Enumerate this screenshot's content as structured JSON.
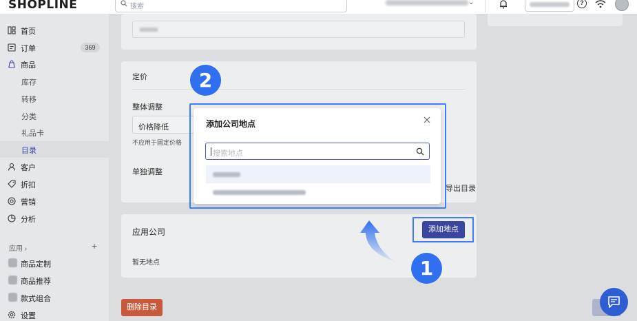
{
  "app": {
    "logo": "SHOPLINE"
  },
  "topbar": {
    "search_placeholder": "搜索"
  },
  "sidebar": {
    "items": [
      {
        "label": "首页",
        "icon": "home-icon"
      },
      {
        "label": "订单",
        "icon": "order-icon",
        "badge": "369"
      },
      {
        "label": "商品",
        "icon": "product-icon"
      },
      {
        "label": "库存"
      },
      {
        "label": "转移"
      },
      {
        "label": "分类"
      },
      {
        "label": "礼品卡"
      },
      {
        "label": "目录"
      },
      {
        "label": "客户",
        "icon": "customer-icon"
      },
      {
        "label": "折扣",
        "icon": "tag-icon"
      },
      {
        "label": "营销",
        "icon": "marketing-icon"
      },
      {
        "label": "分析",
        "icon": "analytics-icon"
      }
    ],
    "apps_header": "应用 ›",
    "apps_plus": "+",
    "apps": [
      {
        "label": "商品定制"
      },
      {
        "label": "商品推荐"
      },
      {
        "label": "款式组合"
      },
      {
        "label": "设置"
      }
    ]
  },
  "main": {
    "pricing": {
      "title": "定价",
      "overall_label": "整体调整",
      "select_value": "价格降低",
      "fixed_note": "不应用于固定价格",
      "single_label": "单独调整",
      "export_label": "导出目录"
    },
    "company": {
      "title": "应用公司",
      "add_button": "添加地点",
      "empty": "暂无地点"
    },
    "delete_button": "删除目录"
  },
  "modal": {
    "title": "添加公司地点",
    "search_placeholder": "搜索地点"
  },
  "callouts": {
    "step1": "1",
    "step2": "2"
  },
  "colors": {
    "accent": "#3b46a1",
    "highlight": "#3d7bff",
    "danger": "#c75a3c"
  }
}
